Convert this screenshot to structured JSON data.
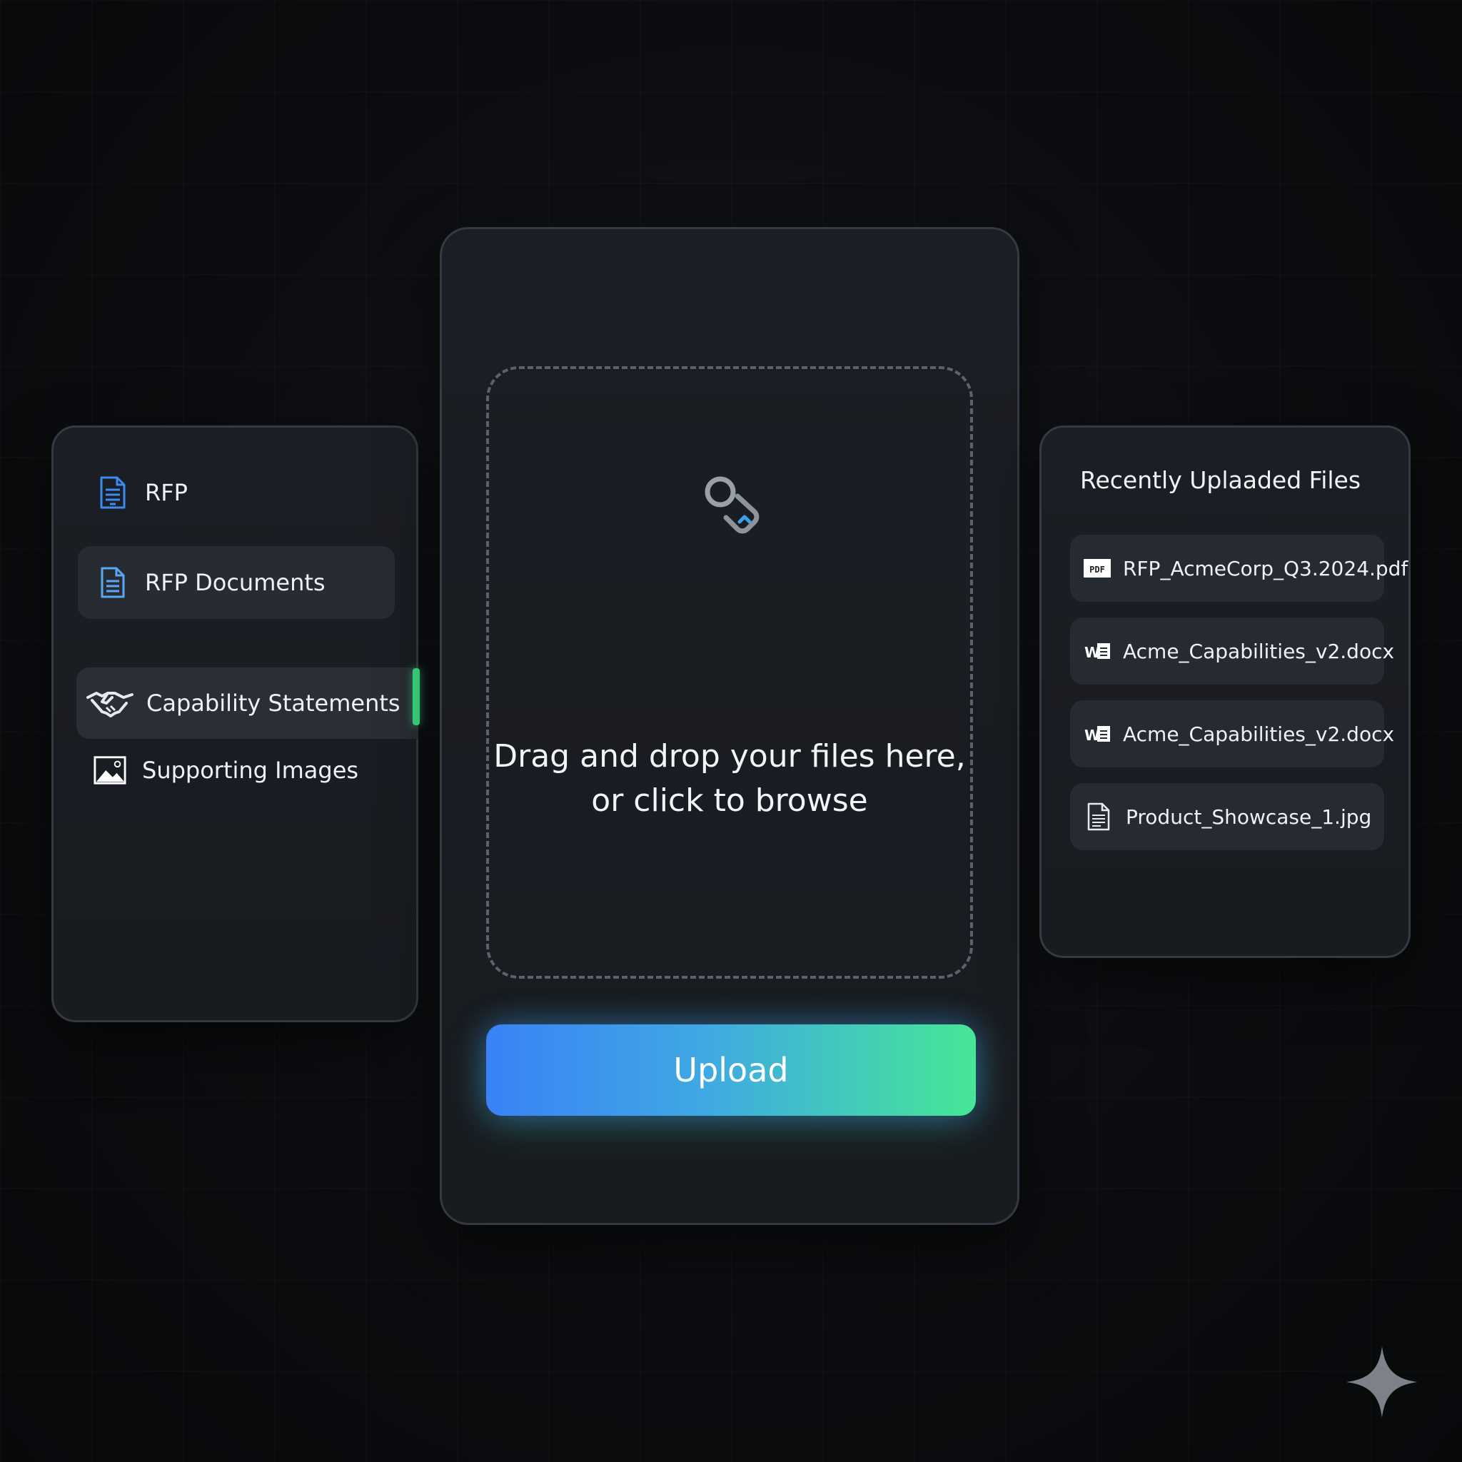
{
  "sidebar": {
    "items": [
      {
        "label": "RFP",
        "icon": "document-icon"
      },
      {
        "label": "RFP Documents",
        "icon": "document-icon"
      },
      {
        "label": "Capability Statements",
        "icon": "handshake-icon",
        "active": true
      },
      {
        "label": "Supporting Images",
        "icon": "image-icon"
      }
    ]
  },
  "upload": {
    "drop_line1": "Drag and drop your files here,",
    "drop_line2": "or click to browse",
    "button_label": "Upload",
    "icon": "upload-link-icon"
  },
  "recent": {
    "title": "Recently Uplaaded Files",
    "files": [
      {
        "name": "RFP_AcmeCorp_Q3.2024.pdf",
        "icon": "pdf-icon",
        "icon_text": "PDF"
      },
      {
        "name": "Acme_Capabilities_v2.docx",
        "icon": "word-icon",
        "icon_text": "W"
      },
      {
        "name": "Acme_Capabilities_v2.docx",
        "icon": "word-icon",
        "icon_text": "W"
      },
      {
        "name": "Product_Showcase_1.jpg",
        "icon": "file-icon"
      }
    ]
  },
  "colors": {
    "accent_green": "#3ddc84",
    "accent_blue": "#3a82f6",
    "icon_blue": "#3b8cf0",
    "panel": "#1b1e24",
    "background": "#0b0c0f"
  }
}
